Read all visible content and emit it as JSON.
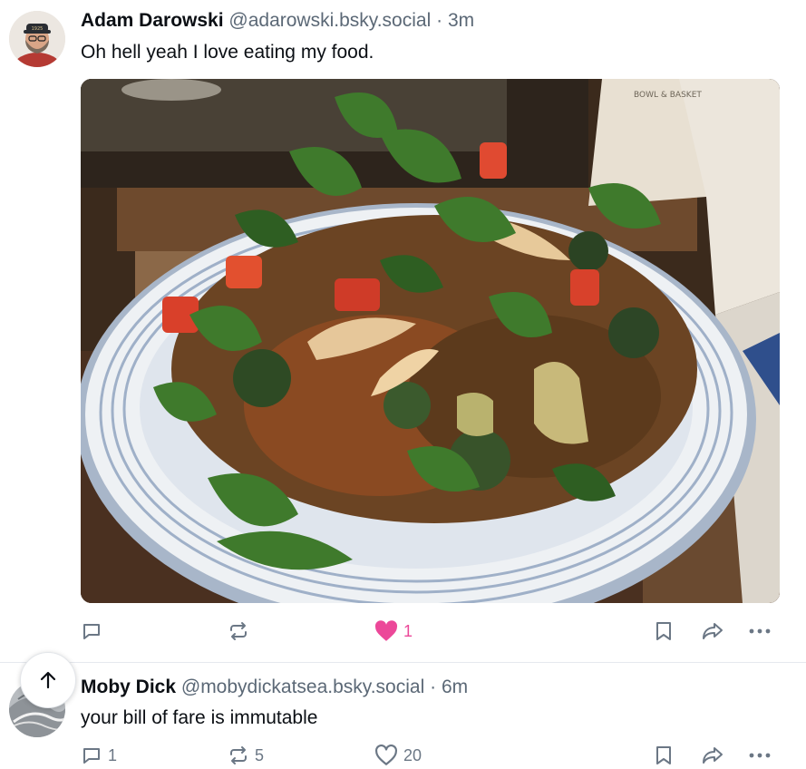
{
  "posts": [
    {
      "author": "Adam Darowski",
      "handle": "@adarowski.bsky.social",
      "separator": "·",
      "time": "3m",
      "text": "Oh hell yeah I love eating my food.",
      "actions": {
        "reply_count": "",
        "repost_count": "",
        "like_count": "1",
        "liked": true
      },
      "image": {
        "alt": "food-photo",
        "package_label": "BOWL & BASKET"
      }
    },
    {
      "author": "Moby Dick",
      "handle": "@mobydickatsea.bsky.social",
      "separator": "·",
      "time": "6m",
      "text": "your bill of fare is immutable",
      "actions": {
        "reply_count": "1",
        "repost_count": "5",
        "like_count": "20",
        "liked": false
      }
    }
  ],
  "colors": {
    "like_active": "#ec4899",
    "muted": "#6b7785",
    "text": "#0b0f14",
    "secondary": "#5b6876"
  },
  "icons": [
    "reply-icon",
    "repost-icon",
    "heart-icon",
    "bookmark-icon",
    "share-icon",
    "more-icon",
    "arrow-up-icon"
  ]
}
